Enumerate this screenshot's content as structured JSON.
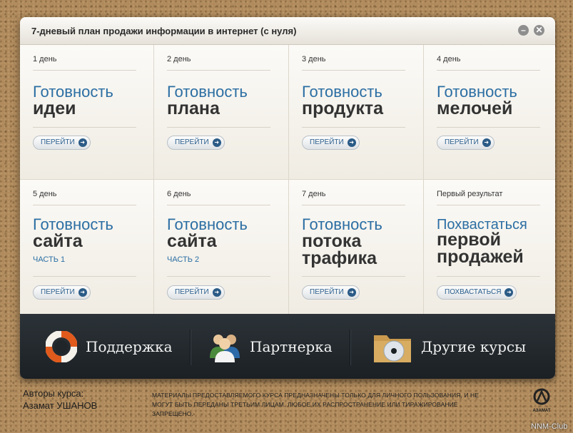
{
  "window": {
    "title": "7-дневый план продажи информации в интернет (с нуля)",
    "minimize_glyph": "–",
    "close_glyph": "✕"
  },
  "cells": [
    {
      "day": "1 день",
      "line1": "Готовность",
      "line2": "идеи",
      "part": "",
      "button": "ПЕРЕЙТИ"
    },
    {
      "day": "2 день",
      "line1": "Готовность",
      "line2": "плана",
      "part": "",
      "button": "ПЕРЕЙТИ"
    },
    {
      "day": "3 день",
      "line1": "Готовность",
      "line2": "продукта",
      "part": "",
      "button": "ПЕРЕЙТИ"
    },
    {
      "day": "4 день",
      "line1": "Готовность",
      "line2": "мелочей",
      "part": "",
      "button": "ПЕРЕЙТИ"
    },
    {
      "day": "5 день",
      "line1": "Готовность",
      "line2": "сайта",
      "part": "ЧАСТЬ 1",
      "button": "ПЕРЕЙТИ"
    },
    {
      "day": "6 день",
      "line1": "Готовность",
      "line2": "сайта",
      "part": "ЧАСТЬ 2",
      "button": "ПЕРЕЙТИ"
    },
    {
      "day": "7 день",
      "line1": "Готовность",
      "line2": "потока",
      "line3": "трафика",
      "part": "",
      "button": "ПЕРЕЙТИ"
    },
    {
      "day": "Первый результат",
      "line1": "Похвастаться",
      "line2": "первой",
      "line3": "продажей",
      "part": "",
      "button": "ПОХВАСТАТЬСЯ"
    }
  ],
  "bottom_bar": {
    "support": "Поддержка",
    "partner": "Партнерка",
    "other_courses": "Другие курсы"
  },
  "footer": {
    "authors_label": "Авторы курса:",
    "author_name": "Азамат УШАНОВ",
    "notice": "Материалы предоставляемого курса предназначены только для личного пользования, и не могут быть переданы третьим лицам. Любое их распространение или тиражирование запрещено.",
    "logo_text": "АЗАМАТ"
  },
  "watermark": "NNM-Club",
  "colors": {
    "accent_blue": "#2b6ea3",
    "button_arrow": "#2b5b86",
    "dark_bar": "#1b2024"
  }
}
